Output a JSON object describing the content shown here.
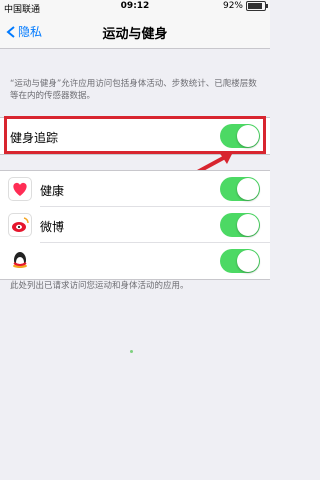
{
  "status_bar": {
    "carrier": "中国联通",
    "time": "09:12",
    "battery": "92%",
    "battery_level": 0.92
  },
  "nav": {
    "back_label": "隐私",
    "title": "运动与健身"
  },
  "description": "“运动与健身”允许应用访问包括身体活动、步数统计、已爬楼层数等在内的传感器数据。",
  "fitness_tracking": {
    "label": "健身追踪",
    "enabled": true
  },
  "apps": [
    {
      "label": "健康",
      "enabled": true
    },
    {
      "label": "微博",
      "enabled": true
    },
    {
      "label": "QQ",
      "enabled": true
    }
  ],
  "footer_note": "此处列出已请求访问您运动和身体活动的应用。",
  "colors": {
    "accent": "#007aff",
    "toggle_on": "#4cd964",
    "highlight": "#d8252f"
  }
}
